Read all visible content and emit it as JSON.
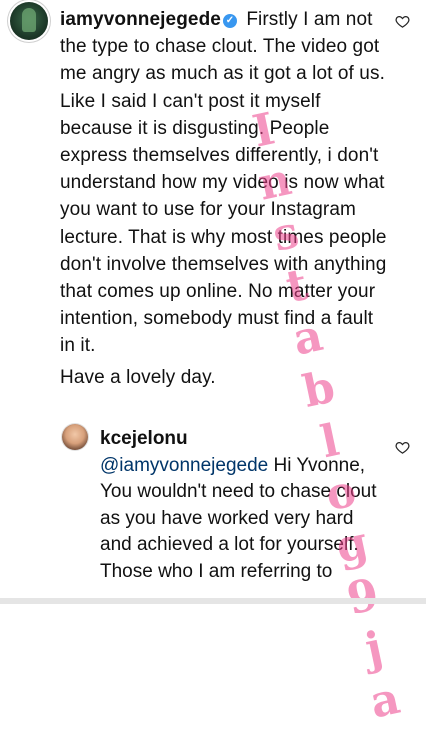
{
  "comment1": {
    "username": "iamyvonnejegede",
    "body": "Firstly I am not the type to chase clout. The video got me angry as much as it got a lot of us. Like I said I can't post it myself because it is disgusting. People express themselves differently, i don't understand how my video is now what you want to use for your Instagram lecture. That is why most times people don't involve themselves with anything that comes up online. No matter your intention, somebody must find a fault in it.",
    "sign_off": "Have a lovely day."
  },
  "comment2": {
    "username": "kcejelonu",
    "mention": "@iamyvonnejegede",
    "body": " Hi Yvonne, You wouldn't need to chase clout as you have worked very hard and achieved a lot for yourself. Those who I am referring to"
  },
  "watermark": {
    "text": "Instablog9ja"
  },
  "icons": {
    "avatar": "avatar",
    "verified": "verified-badge-icon",
    "like": "heart-icon"
  },
  "colors": {
    "verified": "#3897f0",
    "watermark": "#ec428c",
    "mention": "#003569"
  }
}
